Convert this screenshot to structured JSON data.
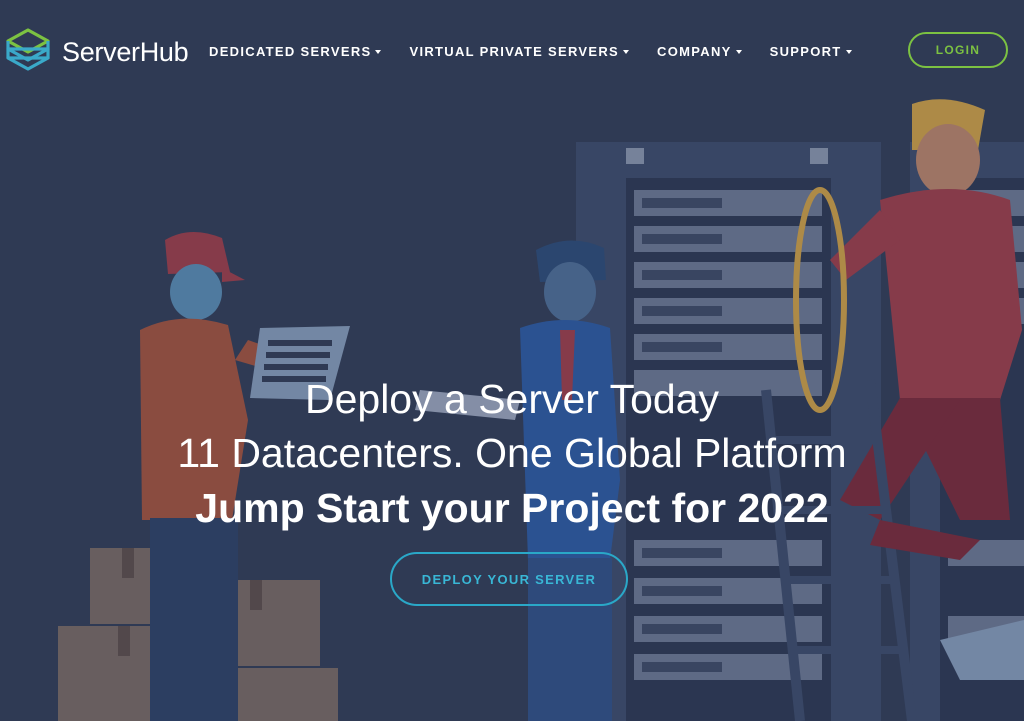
{
  "brand": {
    "name": "ServerHub",
    "logo_icon": "stacked-layers-icon",
    "accent": "#7cc242",
    "teal": "#2aa8c8"
  },
  "nav": {
    "items": [
      {
        "label": "DEDICATED SERVERS"
      },
      {
        "label": "VIRTUAL PRIVATE SERVERS"
      },
      {
        "label": "COMPANY"
      },
      {
        "label": "SUPPORT"
      }
    ],
    "login_label": "LOGIN"
  },
  "hero": {
    "line1": "Deploy a Server Today",
    "line2": "11 Datacenters. One Global Platform",
    "line3": "Jump Start your Project for 2022",
    "cta_label": "DEPLOY YOUR SERVER",
    "background": "#2f3a55"
  }
}
